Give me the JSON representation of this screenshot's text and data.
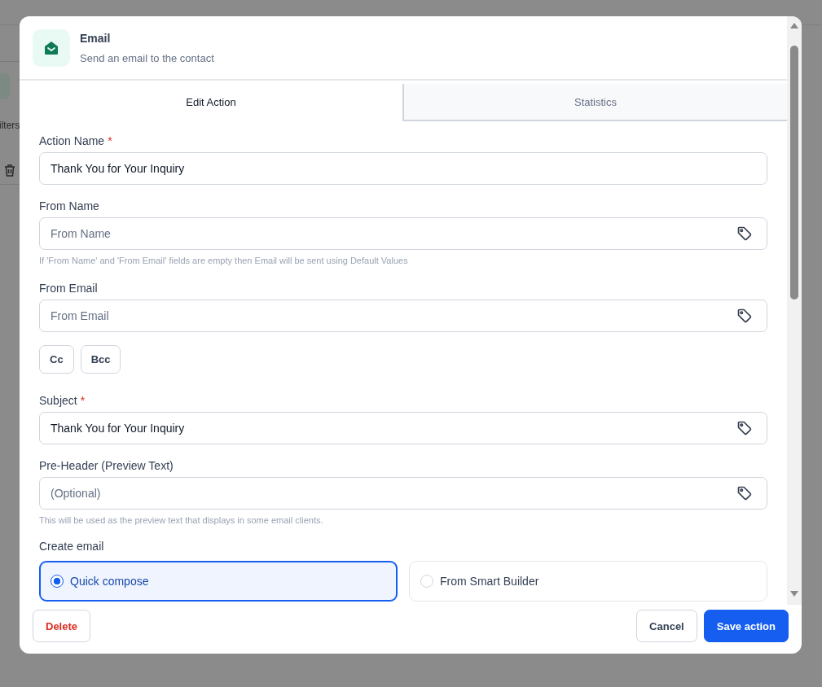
{
  "background": {
    "texts": [
      "ilters"
    ]
  },
  "dialog": {
    "title": "Email",
    "subtitle": "Send an email to the contact"
  },
  "tabs": [
    {
      "label": "Edit Action",
      "selected": true
    },
    {
      "label": "Statistics",
      "selected": false
    }
  ],
  "fields": [
    {
      "kind": "input",
      "label": "Action Name",
      "required_mark": "*",
      "value": "Thank You for Your Inquiry",
      "tag_button": false
    },
    {
      "kind": "input",
      "label": "From Name",
      "placeholder": "From Name",
      "tag_button": true,
      "hint": "If 'From Name' and 'From Email' fields are empty then Email will be sent using Default Values"
    },
    {
      "kind": "input",
      "label": "From Email",
      "placeholder": "From Email",
      "tag_button": true
    },
    {
      "kind": "buttons",
      "buttons": [
        "Cc",
        "Bcc"
      ]
    },
    {
      "kind": "input",
      "label": "Subject",
      "required_mark": "*",
      "value": "Thank You for Your Inquiry",
      "tag_button": true
    },
    {
      "kind": "input",
      "label": "Pre-Header (Preview Text)",
      "placeholder": "(Optional)",
      "tag_button": true,
      "hint": "This will be used as the preview text that displays in some email clients."
    }
  ],
  "create_email": {
    "label": "Create email",
    "options": [
      {
        "label": "Quick compose",
        "selected": true
      },
      {
        "label": "From Smart Builder",
        "selected": false
      }
    ]
  },
  "footer": {
    "delete": "Delete",
    "cancel": "Cancel",
    "save": "Save action"
  }
}
